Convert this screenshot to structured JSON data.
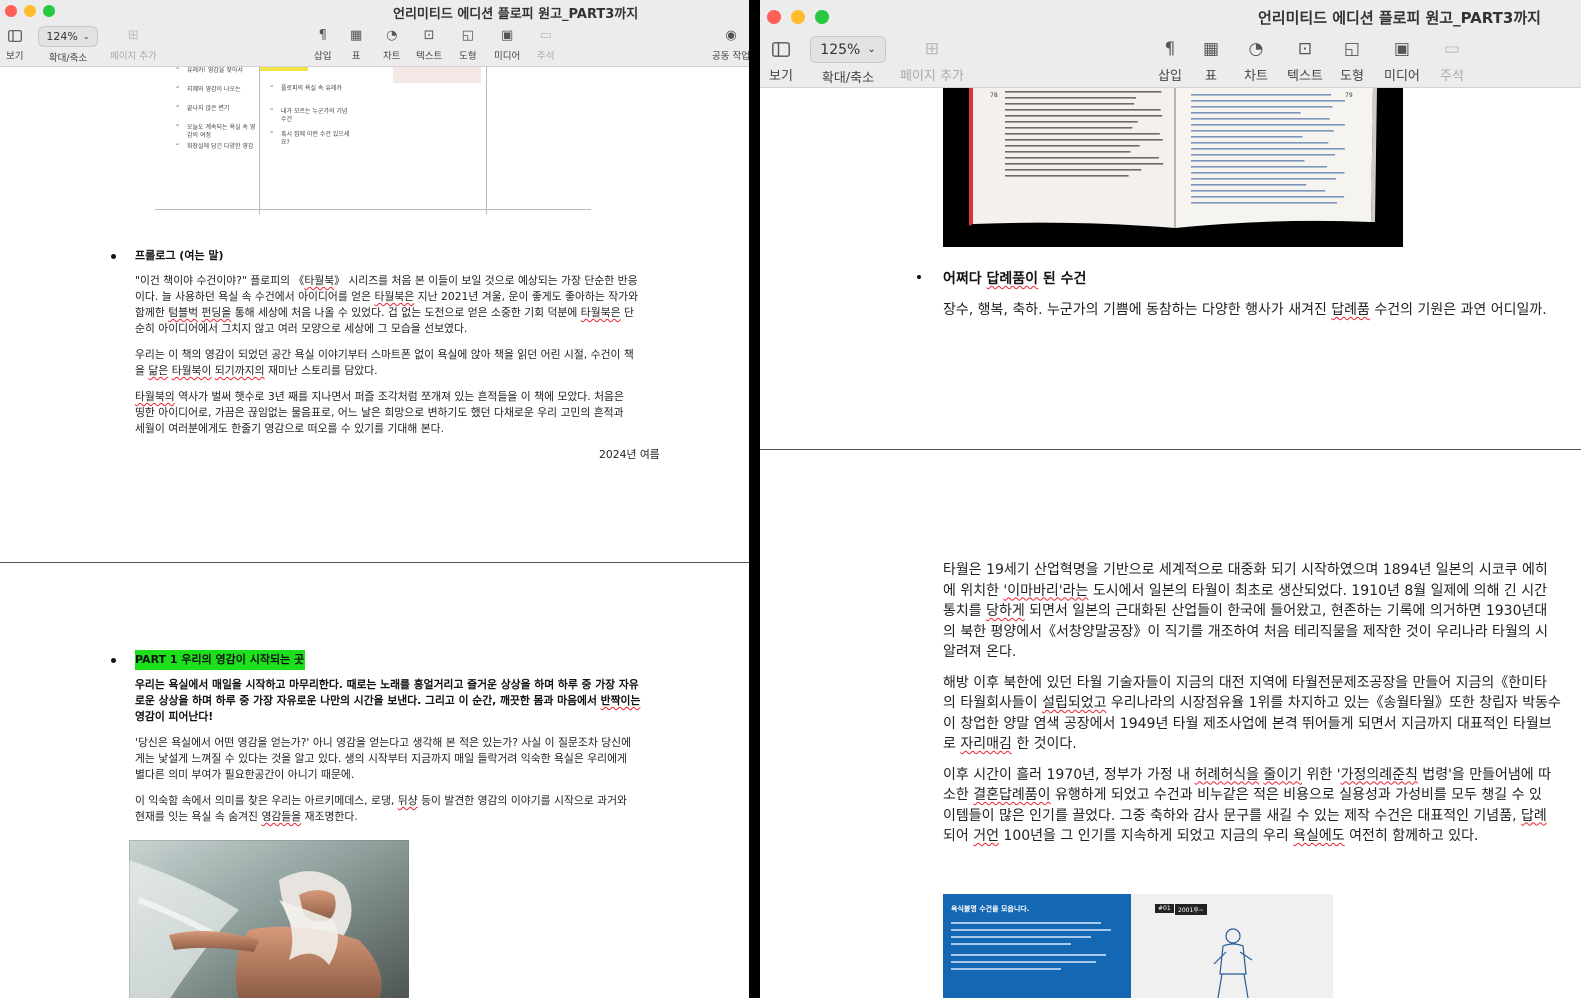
{
  "left_window": {
    "title": "언리미티드 에디션 플로피 원고_PART3까지",
    "toolbar": {
      "view": "보기",
      "zoom_value": "124%",
      "zoom_label": "확대/축소",
      "add_page": "페이지 추가",
      "insert": "삽입",
      "table": "표",
      "chart": "차트",
      "text": "텍스트",
      "shape": "도형",
      "media": "미디어",
      "comment": "주석",
      "collaborate": "공동 작업"
    },
    "diagram": {
      "col1": [
        "유레카! 영감을 찾아서",
        "지혜와 영감이 나오는",
        "끝나지 않은 변기",
        "오늘도 계속되는 욕실 속 영감의 여정",
        "화장실에 담긴 다양한 영감"
      ],
      "col2": [
        "플로피의 욕실 속 유레카",
        "내가 모르는 누군가의 기념수건",
        "혹시 집에 이런 수건 있으세요?"
      ]
    },
    "prologue": {
      "heading": "프롤로그 (여는 말)",
      "p1_lines": [
        [
          "\"이건 책이야 수건이야?\" 플로피의 《",
          {
            "w": "타월북"
          },
          "》 시리즈를 처음 본 이들이 보일 것으로 예상되는 가장 단순한 반응"
        ],
        [
          "이다. 늘 사용하던 욕실 속 수건에서 아이디어를 얻은 ",
          {
            "w": "타월북은"
          },
          " 지난 2021년 겨울, 운이 좋게도 좋아하는 작가와"
        ],
        [
          "함께한 ",
          {
            "w": "텀블벅"
          },
          " ",
          {
            "w": "펀딩을"
          },
          " 통해 세상에 처음 나올 수 있었다. 겁 없는 도전으로 얻은 소중한 기회 덕분에 ",
          {
            "w": "타월북은"
          },
          " 단"
        ],
        [
          "순히 아이디어에서 그치지 않고 여러 모양으로 세상에 그 모습을 선보였다."
        ]
      ],
      "p2_lines": [
        [
          "우리는 이 책의 영감이 되었던 공간 욕실 이야기부터 스마트폰 없이 욕실에 앉아 책을 읽던 어린 시절, 수건이 책"
        ],
        [
          "을 ",
          {
            "w": "닮은"
          },
          " ",
          {
            "w": "타월북이"
          },
          " ",
          {
            "w": "되기까지의"
          },
          " 재미난 스토리를 담았다."
        ]
      ],
      "p3_lines": [
        [
          {
            "w": "타월북의"
          },
          " 역사가 벌써 햇수로 3년 째를 지나면서 퍼즐 조각처럼 쪼개져 있는 흔적들을 이 책에 모았다. 처음은"
        ],
        [
          "띵한 아이디어로, 가끔은 끊임없는 물음표로, 어느 날은 희망으로 변하기도 했던 다채로운 우리 고민의 흔적과"
        ],
        [
          "세월이 여러분에게도 한줄기 영감으로 떠오를 수 있기를 기대해 본다."
        ]
      ],
      "date": "2024년 여름"
    },
    "part1": {
      "heading": "PART 1 우리의 영감이 시작되는 곳",
      "bold_lines": [
        [
          "우리는 욕실에서 매일을 시작하고 마무리한다. 때로는 노래를 흥얼거리고 즐거운 상상을 하며 하루 중 가장 자유"
        ],
        [
          "로운 상상을 하며 하루 중 가장 자유로운 나만의 시간을 보낸다. 그리고 이 순간, 깨끗한 몸과 마음에서 ",
          {
            "w": "반짝이는"
          }
        ],
        [
          "영감이 피어난다!"
        ]
      ],
      "p1_lines": [
        [
          " '당신은 욕실에서 어떤 영감을 얻는가?' 아니 영감을 얻는다고 생각해 본 적은 있는가? 사실 이 질문조차 당신에"
        ],
        [
          "게는 낯설게 느껴질 수 있다는 것을 알고 있다. 생의 시작부터 지금까지 매일 들락거려 익숙한 욕실은 우리에게"
        ],
        [
          "별다른 의미 부여가 필요한공간이 아니기 때문에."
        ]
      ],
      "p2_lines": [
        [
          "이 익숙함 속에서 의미를 찾은 우리는 아르키메데스, 로댕, ",
          {
            "w": "뒤샹"
          },
          " 등이 발견한 영감의 이야기를 시작으로 과거와"
        ],
        [
          "현재를 잇는 욕실 속 숨겨진 ",
          {
            "w": "영감들을"
          },
          " 재조명한다."
        ]
      ]
    }
  },
  "right_window": {
    "title": "언리미티드 에디션 플로피 원고_PART3까지",
    "toolbar": {
      "view": "보기",
      "zoom_value": "125%",
      "zoom_label": "확대/축소",
      "add_page": "페이지 추가",
      "insert": "삽입",
      "table": "표",
      "chart": "차트",
      "text": "텍스트",
      "shape": "도형",
      "media": "미디어",
      "comment": "주석"
    },
    "book_pages": {
      "left_num": "78",
      "right_num": "79"
    },
    "section": {
      "heading_parts": [
        "어쩌다 ",
        {
          "w": "답례품이"
        },
        " 된 수건"
      ],
      "intro_line": [
        "장수, 행복, 축하. 누군가의 기쁨에 동참하는 다양한 행사가 새겨진 ",
        {
          "w": "답례품"
        },
        " 수건의 기원은 과연 어디일까."
      ]
    },
    "body": {
      "p1_lines": [
        [
          "타월은 19세기 산업혁명을 기반으로 세계적으로 대중화 되기 시작하였으며 1894년 일본의 시코쿠 에히"
        ],
        [
          "에 위치한 ",
          {
            "w": "'이마바리'라는"
          },
          " 도시에서 일본의 타월이 최초로 생산되었다. 1910년 8월 일제에 의해 긴 시간"
        ],
        [
          "통치를 ",
          {
            "w": "당하게"
          },
          " 되면서 일본의 근대화된 산업들이 한국에 들어왔고, 현존하는 기록에 의거하면 1930년대"
        ],
        [
          "의 북한 평양에서《서창양말공장》이 직기를 개조하여 처음 테리직물을 제작한 것이 우리나라 타월의 시"
        ],
        [
          "알려져 온다."
        ]
      ],
      "p2_lines": [
        [
          "해방 이후 북한에 있던 타월 기술자들이 지금의 대전 지역에 타월전문제조공장을 만들어 지금의《한미타"
        ],
        [
          "의 타월회사들이 ",
          {
            "w": "설립되었고"
          },
          " 우리나라의 시장점유율 1위를 차지하고 있는《송월타월》또한 창립자 박동수"
        ],
        [
          "이 창업한 양말 염색 공장에서 1949년 타월 제조사업에 본격 뛰어들게 되면서 지금까지 대표적인 타월브"
        ],
        [
          "로 ",
          {
            "w": "자리매김"
          },
          " 한 것이다."
        ]
      ],
      "p3_lines": [
        [
          "이후 시간이 흘러 1970년, 정부가 가정 내 ",
          {
            "w": "허례허식을"
          },
          " ",
          {
            "w": "줄이기"
          },
          " 위한 '",
          {
            "w": "가정의례준칙"
          },
          " 법령'을 만들어냄에 따"
        ],
        [
          "소한 ",
          {
            "w": "결혼답례품이"
          },
          " 유행하게 되었고 수건과 비누같은 적은 비용으로 실용성과 가성비를 모두 챙길 수 있"
        ],
        [
          "이템들이 많은 인기를 끌었다. 그중 축하와 감사 문구를 새길 수 있는 제작 수건은 대표적인 기념품, ",
          {
            "w": "답례"
          }
        ],
        [
          "되어 ",
          {
            "w": "거언"
          },
          " 100년을 그 인기를 지속하게 되었고 지금의 우리 ",
          {
            "w": "욕실에도"
          },
          " 여전히 함께하고 있다."
        ]
      ]
    },
    "image_caption": "욕식불명 수건을 모읍니다.",
    "image_tags": [
      "#01",
      "2001후~"
    ]
  },
  "colors": {
    "highlight": "#1de01d",
    "close": "#ff5f57",
    "minimize": "#febc2e",
    "zoom": "#28c840",
    "spellcheck": "#e23"
  }
}
